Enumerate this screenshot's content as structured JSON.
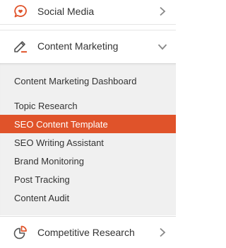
{
  "nav": {
    "social_media": {
      "label": "Social Media",
      "icon": "chat-bubble-icon"
    },
    "content_marketing": {
      "label": "Content Marketing",
      "icon": "pencil-icon",
      "expanded": true,
      "submenu": [
        {
          "label": "Content Marketing Dashboard"
        },
        {
          "label": "Topic Research"
        },
        {
          "label": "SEO Content Template",
          "active": true
        },
        {
          "label": "SEO Writing Assistant"
        },
        {
          "label": "Brand Monitoring"
        },
        {
          "label": "Post Tracking"
        },
        {
          "label": "Content Audit"
        }
      ]
    },
    "competitive_research": {
      "label": "Competitive Research",
      "icon": "pie-chart-icon"
    }
  },
  "colors": {
    "accent": "#e0532a",
    "icon_gray": "#666666",
    "submenu_bg": "#f0f0f0",
    "active_text": "#ffffff"
  }
}
